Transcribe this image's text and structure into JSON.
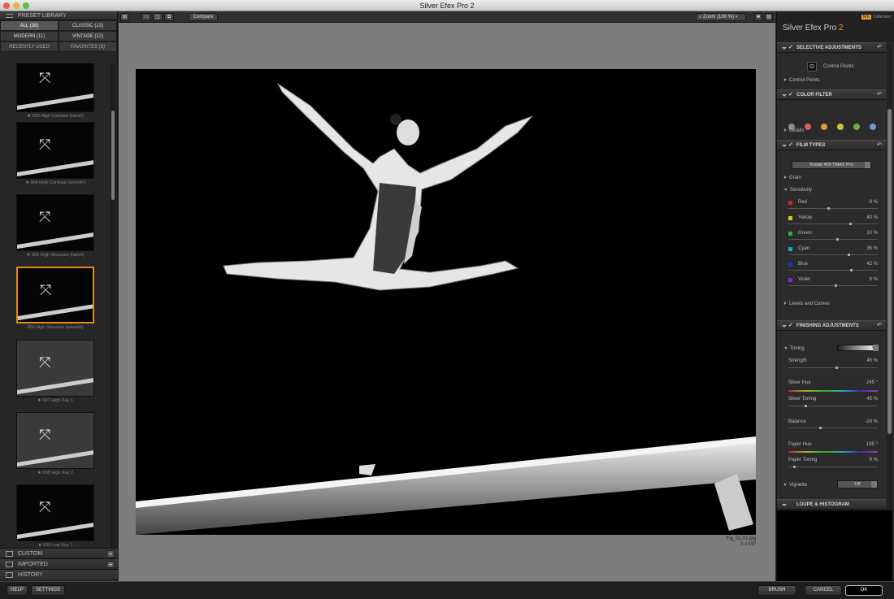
{
  "window": {
    "title": "Silver Efex Pro 2"
  },
  "left": {
    "header": "PRESET LIBRARY",
    "filters": [
      {
        "label": "ALL (38)"
      },
      {
        "label": "CLASSIC (13)"
      },
      {
        "label": "MODERN (11)"
      },
      {
        "label": "VINTAGE (12)"
      },
      {
        "label": "RECENTLY USED"
      },
      {
        "label": "FAVORITES (0)"
      }
    ],
    "presets": [
      {
        "name": ""
      },
      {
        "name": "★ 003 High Contrast (harsh)"
      },
      {
        "name": "★ 004 High Contrast (smooth)"
      },
      {
        "name": "★ 005 High Structure (harsh)"
      },
      {
        "name": "006 High Structure (smooth)"
      },
      {
        "name": "★ 007 High Key 1"
      },
      {
        "name": "★ 008 High Key 2"
      },
      {
        "name": "★ 009 Low Key 1"
      }
    ],
    "bottom": [
      {
        "label": "CUSTOM"
      },
      {
        "label": "IMPORTED"
      },
      {
        "label": "HISTORY"
      }
    ]
  },
  "toolbar": {
    "compare": "Compare",
    "zoom": "Zoom (100 %)"
  },
  "image": {
    "filename": "Fig_01.02.jpg",
    "size": "3.4 MP"
  },
  "right": {
    "brand": "Silver Efex Pro",
    "brand_version": "2",
    "nik_badge": "NIK",
    "nik_label": "Collection",
    "sections": {
      "selective": "SELECTIVE ADJUSTMENTS",
      "color_filter": "COLOR FILTER",
      "film": "FILM TYPES",
      "finishing": "FINISHING ADJUSTMENTS",
      "loupe": "LOUPE & HISTOGRAM"
    },
    "control_points_btn": "Control Points",
    "control_points": "Control Points",
    "details": "Details",
    "film_type": "Kodak 400 TMAX Pro",
    "grain": "Grain",
    "sensitivity": "Sensitivity",
    "sens": [
      {
        "label": "Red",
        "value": "-9 %",
        "color": "#d42020",
        "level": 0.45
      },
      {
        "label": "Yellow",
        "value": "40 %",
        "color": "#d8c81c",
        "level": 0.7
      },
      {
        "label": "Green",
        "value": "10 %",
        "color": "#30b030",
        "level": 0.55
      },
      {
        "label": "Cyan",
        "value": "36 %",
        "color": "#18a8c8",
        "level": 0.68
      },
      {
        "label": "Blue",
        "value": "42 %",
        "color": "#2030c8",
        "level": 0.71
      },
      {
        "label": "Violet",
        "value": "6 %",
        "color": "#8a28c0",
        "level": 0.53
      }
    ],
    "filter_colors": [
      "#8c8c8c",
      "#d66060",
      "#d89a3a",
      "#c8c43a",
      "#6ab04a",
      "#6a9ad0"
    ],
    "levels": "Levels and Curves",
    "toning": "Toning",
    "toning_value": "6",
    "fin": {
      "strength": {
        "label": "Strength",
        "value": "45 %"
      },
      "silver_hue": {
        "label": "Silver Hue",
        "value": "245 °"
      },
      "silver_toning": {
        "label": "Silver Toning",
        "value": "45 %"
      },
      "balance": {
        "label": "Balance",
        "value": "-28 %"
      },
      "paper_hue": {
        "label": "Paper Hue",
        "value": "195 °"
      },
      "paper_toning": {
        "label": "Paper Toning",
        "value": "6 %"
      }
    },
    "vignette": "Vignette",
    "vignette_value": "Off"
  },
  "footer": {
    "help": "HELP",
    "settings": "SETTINGS",
    "brush": "BRUSH",
    "cancel": "CANCEL",
    "ok": "OK"
  }
}
